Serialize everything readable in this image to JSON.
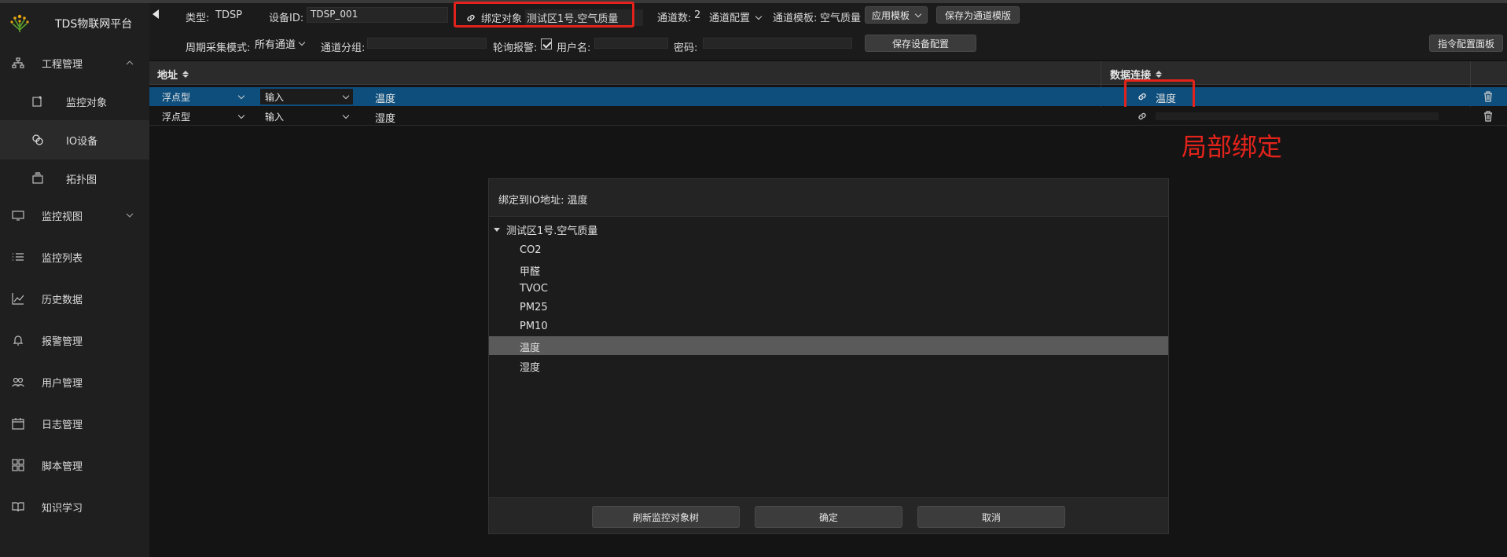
{
  "app": {
    "name": "TDS物联网平台"
  },
  "sidebar": {
    "items": [
      {
        "label": "工程管理",
        "icon": "sitemap-icon"
      },
      {
        "label": "监控对象",
        "icon": "monitor-object-icon"
      },
      {
        "label": "IO设备",
        "icon": "io-device-icon"
      },
      {
        "label": "拓扑图",
        "icon": "topology-icon"
      },
      {
        "label": "监控视图",
        "icon": "monitor-icon"
      },
      {
        "label": "监控列表",
        "icon": "list-icon"
      },
      {
        "label": "历史数据",
        "icon": "chart-line-icon"
      },
      {
        "label": "报警管理",
        "icon": "bell-icon"
      },
      {
        "label": "用户管理",
        "icon": "users-icon"
      },
      {
        "label": "日志管理",
        "icon": "calendar-icon"
      },
      {
        "label": "脚本管理",
        "icon": "grid-icon"
      },
      {
        "label": "知识学习",
        "icon": "book-icon"
      }
    ],
    "active_item": "IO设备"
  },
  "toolbar": {
    "type_label": "类型:",
    "type_value": "TDSP",
    "device_id_label": "设备ID:",
    "device_id_value": "TDSP_001",
    "bind_label": "绑定对象",
    "bind_value": "测试区1号.空气质量",
    "channel_count_label": "通道数:",
    "channel_count_value": "2",
    "channel_config_label": "通道配置",
    "channel_template_label": "通道模板:",
    "channel_template_value": "空气质量",
    "apply_template_label": "应用模板",
    "save_as_template_label": "保存为通道模版",
    "period_mode_label": "周期采集模式:",
    "period_mode_value": "所有通道",
    "channel_group_label": "通道分组:",
    "channel_group_value": "",
    "poll_alarm_label": "轮询报警:",
    "poll_alarm_checked": true,
    "username_label": "用户名:",
    "username_value": "",
    "password_label": "密码:",
    "password_value": "",
    "save_device_config_label": "保存设备配置",
    "command_panel_label": "指令配置面板"
  },
  "table": {
    "columns": [
      "地址",
      "数据连接"
    ],
    "rows": [
      {
        "data_type": "浮点型",
        "direction": "输入",
        "name": "温度",
        "link": "温度",
        "selected": true
      },
      {
        "data_type": "浮点型",
        "direction": "输入",
        "name": "湿度",
        "link": "",
        "selected": false
      }
    ]
  },
  "annotation": {
    "text": "局部绑定",
    "color": "#e3231b"
  },
  "dialog": {
    "title": "绑定到IO地址:  温度",
    "tree": {
      "root": "测试区1号.空气质量",
      "children": [
        "CO2",
        "甲醛",
        "TVOC",
        "PM25",
        "PM10",
        "温度",
        "湿度"
      ],
      "selected": "温度"
    },
    "buttons": {
      "refresh": "刷新监控对象树",
      "ok": "确定",
      "cancel": "取消"
    }
  },
  "colors": {
    "selected_row": "#0d4e7c",
    "highlight_border": "#e3231b",
    "background": "#141414",
    "sidebar": "#1f1f1f"
  }
}
